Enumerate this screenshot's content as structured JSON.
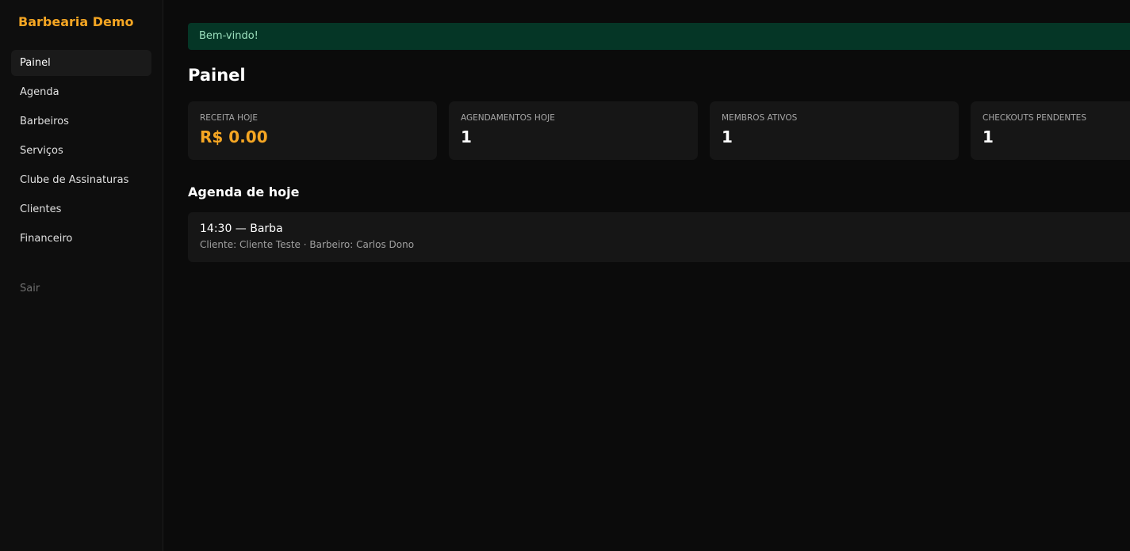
{
  "sidebar": {
    "brand": "Barbearia Demo",
    "items": [
      {
        "label": "Painel",
        "active": true
      },
      {
        "label": "Agenda"
      },
      {
        "label": "Barbeiros"
      },
      {
        "label": "Serviços"
      },
      {
        "label": "Clube de Assinaturas"
      },
      {
        "label": "Clientes"
      },
      {
        "label": "Financeiro"
      }
    ],
    "logout": "Sair"
  },
  "flash": {
    "message": "Bem-vindo!"
  },
  "page": {
    "title": "Painel"
  },
  "stats": [
    {
      "label": "RECEITA HOJE",
      "value": "R$ 0.00"
    },
    {
      "label": "AGENDAMENTOS HOJE",
      "value": "1"
    },
    {
      "label": "MEMBROS ATIVOS",
      "value": "1"
    },
    {
      "label": "CHECKOUTS PENDENTES",
      "value": "1"
    }
  ],
  "agenda": {
    "title": "Agenda de hoje",
    "items": [
      {
        "title": "14:30 — Barba",
        "subtitle": "Cliente: Cliente Teste · Barbeiro: Carlos Dono"
      }
    ]
  },
  "colors": {
    "accent": "#f5a623",
    "background": "#0b0b0b",
    "card": "#161616",
    "flash_bg": "#053626",
    "flash_text": "#9be0bd"
  }
}
